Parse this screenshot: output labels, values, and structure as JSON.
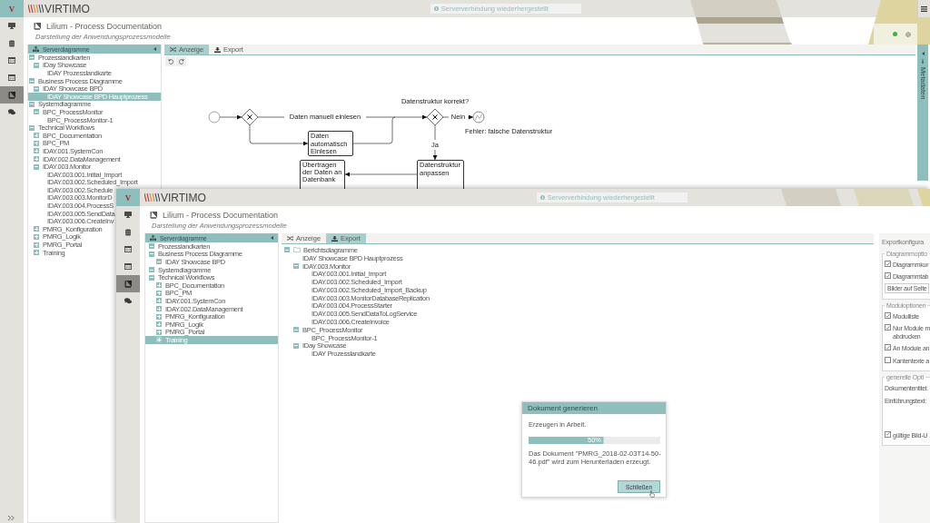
{
  "back_window": {
    "badge": "V",
    "logo": "VIRTIMO",
    "notification": "Serververbindung wiederhergestellt",
    "sidebar_items": [
      {
        "selected": false
      },
      {
        "selected": false
      },
      {
        "selected": false
      },
      {
        "selected": false
      },
      {
        "selected": true
      },
      {
        "selected": false
      }
    ],
    "title": "Lilium - Process Documentation",
    "subtitle": "Darstellung der Anwendungsprozessmodelle",
    "status": {
      "connected": true
    },
    "tree": {
      "header": "Serverdiagramme",
      "items": [
        {
          "label": "Prozesslandkarten",
          "expanded": true,
          "selected": false,
          "children": [
            {
              "label": "IDay Showcase",
              "expanded": true,
              "selected": false,
              "children": [
                {
                  "label": "IDAY Prozesslandkarte",
                  "selected": false
                }
              ]
            }
          ]
        },
        {
          "label": "Business Process Diagramme",
          "expanded": true,
          "selected": false,
          "children": [
            {
              "label": "IDAY Showcase BPD",
              "expanded": true,
              "selected": false,
              "children": [
                {
                  "label": "IDAY Showcase BPD Hauptprozess",
                  "selected": true
                }
              ]
            }
          ]
        },
        {
          "label": "Systemdiagramme",
          "expanded": true,
          "selected": false,
          "children": [
            {
              "label": "BPC_ProcessMonitor",
              "expanded": true,
              "selected": false,
              "children": [
                {
                  "label": "BPC_ProcessMonitor-1",
                  "selected": false
                }
              ]
            }
          ]
        },
        {
          "label": "Technical Workflows",
          "expanded": true,
          "selected": false,
          "children": [
            {
              "label": "BPC_Documentation",
              "expanded": false,
              "selected": false
            },
            {
              "label": "BPC_PM",
              "expanded": false,
              "selected": false
            },
            {
              "label": "IDAY.001.SystemCon",
              "expanded": false,
              "selected": false
            },
            {
              "label": "IDAY.002.DataManagement",
              "expanded": false,
              "selected": false
            },
            {
              "label": "IDAY.003.Monitor",
              "expanded": true,
              "selected": false,
              "children": [
                {
                  "label": "IDAY.003.001.Initial_Import",
                  "selected": false
                },
                {
                  "label": "IDAY.003.002.Scheduled_Import",
                  "selected": false
                },
                {
                  "label": "IDAY.003.002.Schedule",
                  "selected": false
                },
                {
                  "label": "IDAY.003.003.MonitorD",
                  "selected": false
                },
                {
                  "label": "IDAY.003.004.ProcessS",
                  "selected": false
                },
                {
                  "label": "IDAY.003.005.SendData",
                  "selected": false
                },
                {
                  "label": "IDAY.003.006.CreateInv",
                  "selected": false
                }
              ]
            },
            {
              "label": "PMRG_Konfiguration",
              "expanded": false,
              "selected": false
            },
            {
              "label": "PMRG_Logik",
              "expanded": false,
              "selected": false
            },
            {
              "label": "PMRG_Portal",
              "expanded": false,
              "selected": false
            },
            {
              "label": "Training",
              "expanded": false,
              "selected": false
            }
          ]
        }
      ]
    },
    "tabs": [
      {
        "label": "Anzeige",
        "selected": true
      },
      {
        "label": "Export",
        "selected": false
      }
    ],
    "diagram": {
      "tasks": [
        "Daten automatisch Einlesen",
        "Übertragen der Daten an Datenbank",
        "Datenstruktur anpassen"
      ],
      "flow_labels": [
        "Daten manuell einlesen",
        "Nein",
        "Ja"
      ],
      "gateway_question": "Datenstruktur korrekt?",
      "error_label": "Fehler: falsche Datenstruktur"
    },
    "side_panel": {
      "label": "Metadaten"
    }
  },
  "front_window": {
    "badge": "V",
    "logo": "VIRTIMO",
    "notification": "Serververbindung wiederhergestellt",
    "sidebar_items": [
      {
        "selected": false
      },
      {
        "selected": false
      },
      {
        "selected": false
      },
      {
        "selected": false
      },
      {
        "selected": true
      },
      {
        "selected": false
      }
    ],
    "title": "Lilium - Process Documentation",
    "subtitle": "Darstellung der Anwendungsprozessmodelle",
    "tree": {
      "header": "Serverdiagramme",
      "items": [
        {
          "label": "Prozesslandkarten",
          "expanded": true,
          "selected": false
        },
        {
          "label": "Business Process Diagramme",
          "expanded": true,
          "selected": false,
          "children": [
            {
              "label": "IDAY Showcase BPD",
              "expanded": true,
              "selected": false
            }
          ]
        },
        {
          "label": "Systemdiagramme",
          "expanded": true,
          "selected": false
        },
        {
          "label": "Technical Workflows",
          "expanded": true,
          "selected": false,
          "children": [
            {
              "label": "BPC_Documentation",
              "expanded": false,
              "selected": false
            },
            {
              "label": "BPC_PM",
              "expanded": false,
              "selected": false
            },
            {
              "label": "IDAY.001.SystemCon",
              "expanded": false,
              "selected": false
            },
            {
              "label": "IDAY.002.DataManagement",
              "expanded": false,
              "selected": false
            },
            {
              "label": "PMRG_Konfiguration",
              "expanded": false,
              "selected": false
            },
            {
              "label": "PMRG_Logik",
              "expanded": false,
              "selected": false
            },
            {
              "label": "PMRG_Portal",
              "expanded": false,
              "selected": false
            },
            {
              "label": "Training",
              "expanded": false,
              "selected": true
            }
          ]
        }
      ]
    },
    "tabs": [
      {
        "label": "Anzeige",
        "selected": false
      },
      {
        "label": "Export",
        "selected": true
      }
    ],
    "export_tree": [
      {
        "label": "Berichtsdiagramme",
        "kind": "folder",
        "expanded": true,
        "selected": false,
        "children": [
          {
            "label": "IDAY Showcase BPD Hauptprozess",
            "selected": false
          },
          {
            "label": "IDAY.003.Monitor",
            "expanded": true,
            "selected": false,
            "children": [
              {
                "label": "IDAY.003.001.Initial_Import",
                "selected": false
              },
              {
                "label": "IDAY.003.002.Scheduled_Import",
                "selected": false
              },
              {
                "label": "IDAY.003.002.Scheduled_Import_Backup",
                "selected": false
              },
              {
                "label": "IDAY.003.003.MonitorDatabaseReplication",
                "selected": false
              },
              {
                "label": "IDAY.003.004.ProcessStarter",
                "selected": false
              },
              {
                "label": "IDAY.003.005.SendDataToLogService",
                "selected": false
              },
              {
                "label": "IDAY.003.006.CreateInvoice",
                "selected": false
              }
            ]
          },
          {
            "label": "BPC_ProcessMonitor",
            "expanded": true,
            "selected": false,
            "children": [
              {
                "label": "BPC_ProcessMonitor-1",
                "selected": false
              }
            ]
          },
          {
            "label": "IDay Showcase",
            "expanded": true,
            "selected": false,
            "children": [
              {
                "label": "IDAY Prozesslandkarte",
                "selected": false
              }
            ]
          }
        ]
      }
    ],
    "config": {
      "title": "Exportkonfigura",
      "groups": [
        {
          "legend": "Diagrammoptio",
          "options": [
            {
              "kind": "checkbox",
              "label": "Diagrammkur",
              "checked": true
            },
            {
              "kind": "checkbox",
              "label": "Diagrammtab",
              "checked": true
            },
            {
              "kind": "select",
              "value": "Bilder auf Seite"
            }
          ]
        },
        {
          "legend": "Moduloptionen",
          "options": [
            {
              "kind": "checkbox",
              "label": "Modulliste",
              "checked": true
            },
            {
              "kind": "checkbox",
              "label": "Nur Module m",
              "label_line2": "abdrucken",
              "checked": true
            },
            {
              "kind": "checkbox",
              "label": "An Module an",
              "checked": true
            },
            {
              "kind": "checkbox",
              "label": "Kantentexte a",
              "checked": false
            }
          ]
        },
        {
          "legend": "generelle Opti",
          "options": [
            {
              "kind": "field_label",
              "label": "Dokumententitel:"
            },
            {
              "kind": "textarea_label",
              "label": "Einführungstext:"
            },
            {
              "kind": "checkbox",
              "label": "gültige Bild-U",
              "checked": true
            }
          ]
        }
      ]
    },
    "dialog": {
      "title": "Dokument generieren",
      "status": "Erzeugen in Arbeit.",
      "level": 0.5,
      "reading": "50%",
      "message": "Das Dokument \"PMRG_2018-02-03T14-50-46.pdf\" wird zum Herunterladen erzeugt.",
      "button": "Schließen"
    }
  }
}
